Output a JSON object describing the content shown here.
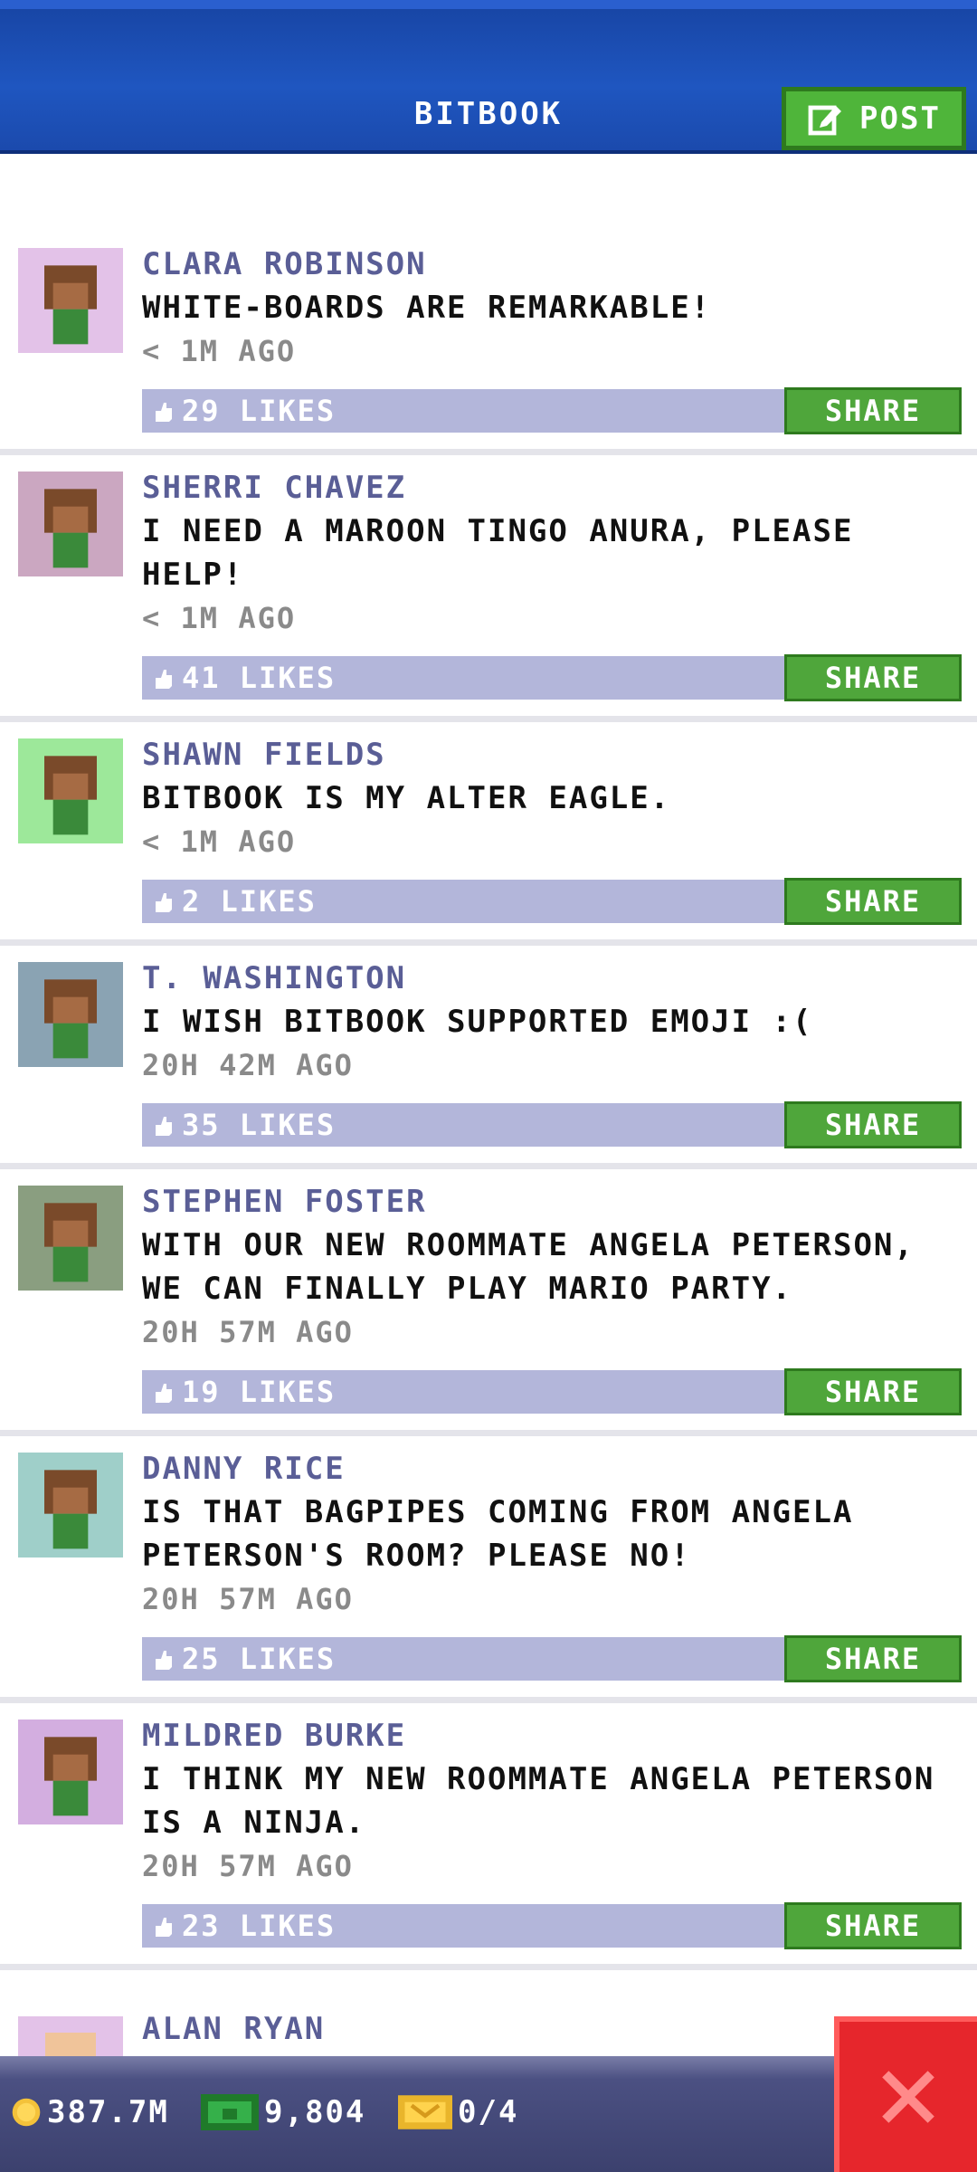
{
  "header": {
    "title": "BITBOOK",
    "post_label": "POST"
  },
  "posts": [
    {
      "author": "CLARA ROBINSON",
      "message": "WHITE-BOARDS ARE REMARKABLE!",
      "time": "< 1M AGO",
      "likes": "29 LIKES",
      "share": "SHARE",
      "avatar_bg": "#e3c2e8"
    },
    {
      "author": "SHERRI CHAVEZ",
      "message": "I NEED A MAROON TINGO ANURA, PLEASE HELP!",
      "time": "< 1M AGO",
      "likes": "41 LIKES",
      "share": "SHARE",
      "avatar_bg": "#cba7c1"
    },
    {
      "author": "SHAWN FIELDS",
      "message": "BITBOOK IS MY ALTER EAGLE.",
      "time": "< 1M AGO",
      "likes": "2 LIKES",
      "share": "SHARE",
      "avatar_bg": "#9de89a"
    },
    {
      "author": "T. WASHINGTON",
      "message": "I WISH BITBOOK SUPPORTED EMOJI :(",
      "time": "20H 42M AGO",
      "likes": "35 LIKES",
      "share": "SHARE",
      "avatar_bg": "#8aa3b3"
    },
    {
      "author": "STEPHEN FOSTER",
      "message": "WITH OUR NEW ROOMMATE ANGELA PETERSON, WE CAN FINALLY PLAY MARIO PARTY.",
      "time": "20H 57M AGO",
      "likes": "19 LIKES",
      "share": "SHARE",
      "avatar_bg": "#8a9e80"
    },
    {
      "author": "DANNY RICE",
      "message": "IS THAT BAGPIPES COMING FROM ANGELA PETERSON'S ROOM? PLEASE NO!",
      "time": "20H 57M AGO",
      "likes": "25 LIKES",
      "share": "SHARE",
      "avatar_bg": "#9fcfc9"
    },
    {
      "author": "MILDRED BURKE",
      "message": "I THINK MY NEW ROOMMATE ANGELA PETERSON IS A NINJA.",
      "time": "20H 57M AGO",
      "likes": "23 LIKES",
      "share": "SHARE",
      "avatar_bg": "#d3aee0"
    }
  ],
  "partial_post": {
    "author": "ALAN RYAN"
  },
  "status": {
    "coins": "387.7M",
    "bux": "9,804",
    "tickets": "0/4"
  },
  "colors": {
    "header": "#1f56c0",
    "share_green": "#4fa63b",
    "likes_bar": "#b3b6da",
    "author": "#5a5e96",
    "close_red": "#e6262c"
  },
  "icons": [
    "edit-icon",
    "thumbs-up-icon",
    "coin-icon",
    "bux-icon",
    "ticket-icon",
    "close-icon"
  ]
}
